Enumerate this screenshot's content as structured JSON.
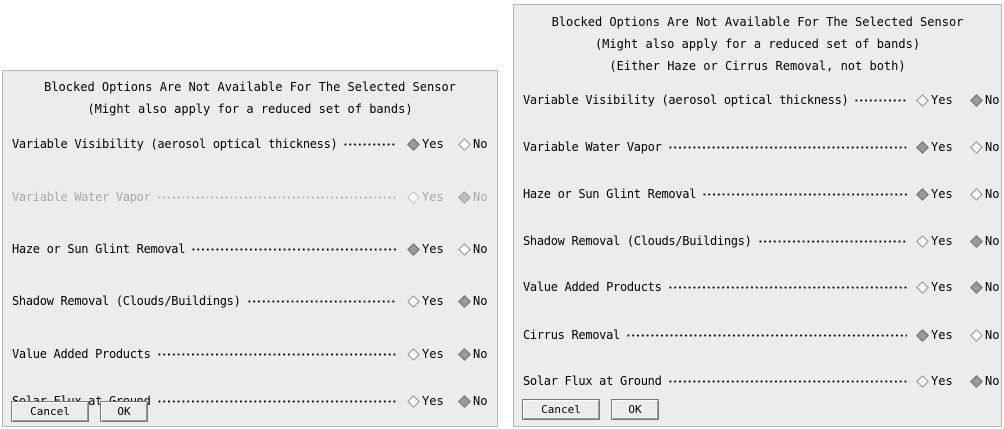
{
  "left_dialog": {
    "header": [
      "Blocked Options Are Not Available For The Selected Sensor",
      "(Might also apply for a reduced set of bands)"
    ],
    "options": [
      {
        "label": "Variable Visibility (aerosol optical thickness)",
        "yes_label": "Yes",
        "no_label": "No",
        "selected": "Yes",
        "disabled": false
      },
      {
        "label": "Variable Water Vapor",
        "yes_label": "Yes",
        "no_label": "No",
        "selected": "No",
        "disabled": true
      },
      {
        "label": "Haze or Sun Glint Removal",
        "yes_label": "Yes",
        "no_label": "No",
        "selected": "Yes",
        "disabled": false
      },
      {
        "label": "Shadow Removal (Clouds/Buildings)",
        "yes_label": "Yes",
        "no_label": "No",
        "selected": "No",
        "disabled": false
      },
      {
        "label": "Value Added Products",
        "yes_label": "Yes",
        "no_label": "No",
        "selected": "No",
        "disabled": false
      },
      {
        "label": "Solar Flux at Ground",
        "yes_label": "Yes",
        "no_label": "No",
        "selected": "No",
        "disabled": false
      }
    ],
    "buttons": {
      "cancel": "Cancel",
      "ok": "OK"
    }
  },
  "right_dialog": {
    "header": [
      "Blocked Options Are Not Available For The Selected Sensor",
      "(Might also apply for a reduced set of bands)",
      "(Either Haze or Cirrus Removal, not both)"
    ],
    "options": [
      {
        "label": "Variable Visibility (aerosol optical thickness)",
        "yes_label": "Yes",
        "no_label": "No",
        "selected": "No",
        "disabled": false
      },
      {
        "label": "Variable Water Vapor",
        "yes_label": "Yes",
        "no_label": "No",
        "selected": "Yes",
        "disabled": false
      },
      {
        "label": "Haze or Sun Glint Removal",
        "yes_label": "Yes",
        "no_label": "No",
        "selected": "Yes",
        "disabled": false
      },
      {
        "label": "Shadow Removal (Clouds/Buildings)",
        "yes_label": "Yes",
        "no_label": "No",
        "selected": "No",
        "disabled": false
      },
      {
        "label": "Value Added Products",
        "yes_label": "Yes",
        "no_label": "No",
        "selected": "No",
        "disabled": false
      },
      {
        "label": "Cirrus Removal",
        "yes_label": "Yes",
        "no_label": "No",
        "selected": "Yes",
        "disabled": false
      },
      {
        "label": "Solar Flux at Ground",
        "yes_label": "Yes",
        "no_label": "No",
        "selected": "No",
        "disabled": false
      }
    ],
    "buttons": {
      "cancel": "Cancel",
      "ok": "OK"
    }
  }
}
